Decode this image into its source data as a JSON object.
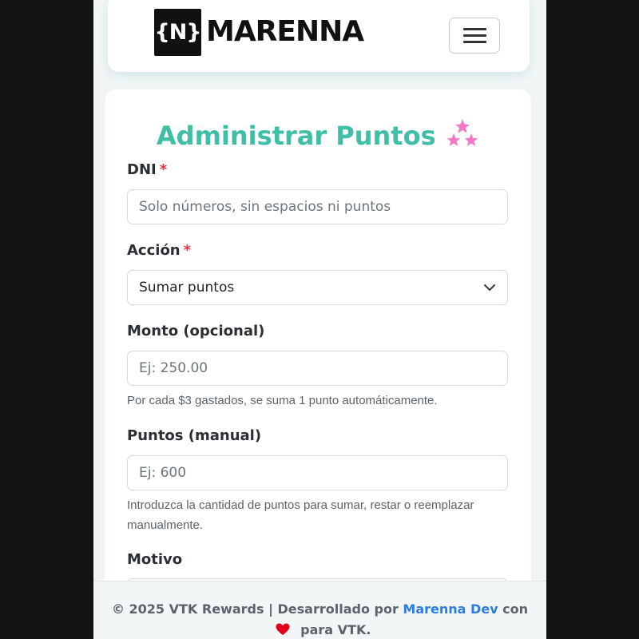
{
  "navbar": {
    "logo_mark": "{N}",
    "brand": "MARENNA",
    "menu_icon": "hamburger-icon"
  },
  "form": {
    "title": "Administrar Puntos",
    "title_icon": "stars-icon",
    "required_mark": "*",
    "dni": {
      "label": "DNI",
      "placeholder": "Solo números, sin espacios ni puntos",
      "value": ""
    },
    "accion": {
      "label": "Acción",
      "selected": "Sumar puntos"
    },
    "monto": {
      "label": "Monto (opcional)",
      "placeholder": "Ej: 250.00",
      "help": "Por cada $3 gastados, se suma 1 punto automáticamente."
    },
    "puntos": {
      "label": "Puntos (manual)",
      "placeholder": "Ej: 600",
      "help": "Introduzca la cantidad de puntos para sumar, restar o reemplazar manualmente."
    },
    "motivo": {
      "label": "Motivo"
    }
  },
  "footer": {
    "prefix": "© 2025 VTK Rewards | Desarrollado por",
    "link": "Marenna Dev",
    "middle": "con",
    "suffix": "para VTK."
  },
  "colors": {
    "accent": "#3fbfa6",
    "required": "#dc3545",
    "link": "#2a7de1",
    "heart": "#e3001b",
    "stars": "#f37ac9"
  }
}
